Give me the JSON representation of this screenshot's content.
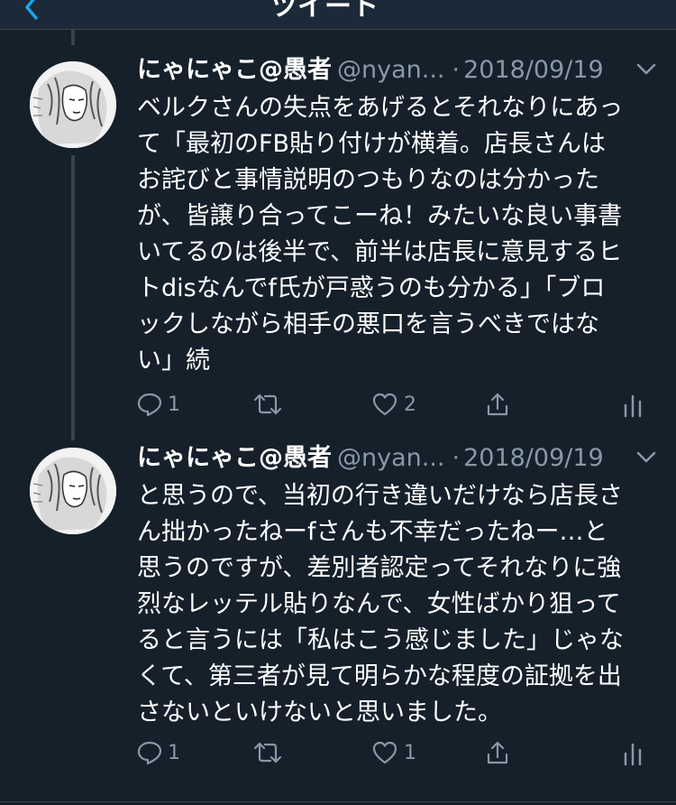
{
  "header": {
    "title": "ツイート"
  },
  "tweets": [
    {
      "name": "にゃにゃこ@愚者",
      "handle": "@nyan...",
      "dot": "·",
      "date": "2018/09/19",
      "text": "ベルクさんの失点をあげるとそれなりにあっ\nて「最初のFB貼り付けが横着。店長さんは\nお詫びと事情説明のつもりなのは分かった\nが、皆譲り合ってこーね！みたいな良い事書\nいてるのは後半で、前半は店長に意見するヒ\nトdisなんでf氏が戸惑うのも分かる」「ブロ\nックしながら相手の悪口を言うべきではな\nい」続",
      "reply_count": "1",
      "retweet_count": "",
      "like_count": "2"
    },
    {
      "name": "にゃにゃこ@愚者",
      "handle": "@nyan...",
      "dot": "·",
      "date": "2018/09/19",
      "text": "と思うので、当初の行き違いだけなら店長さ\nん拙かったねーfさんも不幸だったねー…と\n思うのですが、差別者認定ってそれなりに強\n烈なレッテル貼りなんで、女性ばかり狙って\nると言うには「私はこう感じました」じゃな\nくて、第三者が見て明らかな程度の証拠を出\nさないといけないと思いました。",
      "reply_count": "1",
      "retweet_count": "",
      "like_count": "1"
    }
  ],
  "icons": {
    "back": "back-arrow-icon",
    "caret": "chevron-down-icon",
    "reply": "reply-icon",
    "retweet": "retweet-icon",
    "like": "heart-icon",
    "share": "share-icon",
    "analytics": "analytics-icon"
  },
  "colors": {
    "background": "#15202b",
    "header_background": "#1c2938",
    "accent": "#1da1f2",
    "secondary_text": "#8899a6",
    "divider": "#38444d"
  }
}
